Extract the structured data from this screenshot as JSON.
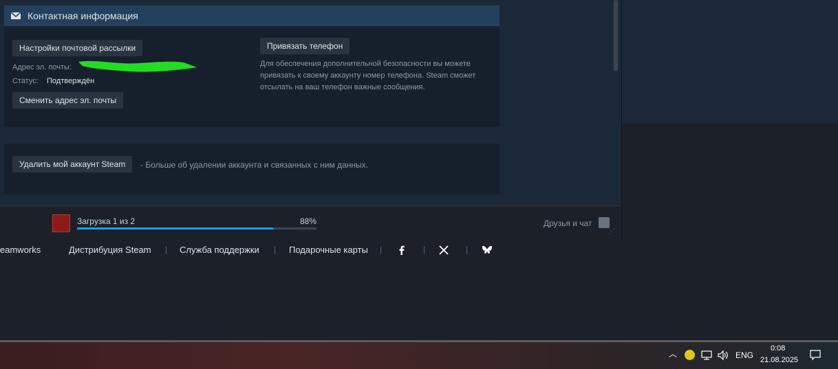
{
  "contact": {
    "title": "Контактная информация",
    "newsletter_button": "Настройки почтовой рассылки",
    "email_label": "Адрес эл. почты:",
    "status_label": "Статус:",
    "status_value": "Подтверждён",
    "change_email_button": "Сменить адрес эл. почты",
    "bind_phone_button": "Привязать телефон",
    "phone_description": "Для обеспечения дополнительной безопасности вы можете привязать к своему аккаунту номер телефона. Steam сможет отсылать на ваш телефон важные сообщения."
  },
  "account": {
    "delete_button": "Удалить мой аккаунт Steam",
    "delete_note": "- Больше об удалении аккаунта и связанных с ним данных."
  },
  "download": {
    "text": "Загрузка 1 из 2",
    "percent_label": "88%",
    "progress": 0.88
  },
  "friends_chat": "Друзья и чат",
  "footer": {
    "links": [
      "eamworks",
      "Дистрибуция Steam",
      "Служба поддержки",
      "Подарочные карты"
    ],
    "separator": "|"
  },
  "taskbar": {
    "lang": "ENG",
    "time": "0:08",
    "date": "21.08.2025"
  },
  "colors": {
    "accent": "#1a9fff",
    "redaction": "#22dd22"
  }
}
